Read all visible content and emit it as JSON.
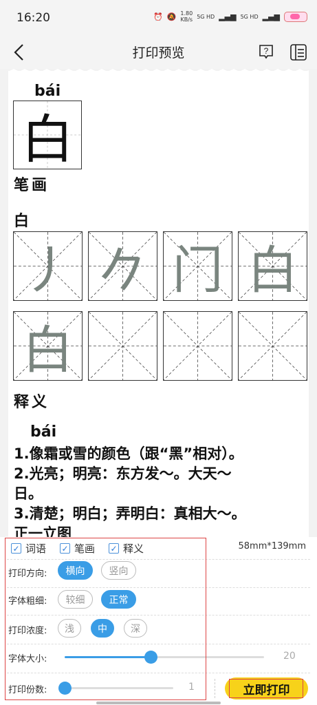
{
  "status": {
    "time": "16:20",
    "net_speed_value": "1.80",
    "net_speed_unit": "KB/s",
    "sig1": "5G HD",
    "sig2": "5G HD"
  },
  "nav": {
    "title": "打印预览"
  },
  "preview": {
    "pinyin": "bái",
    "character": "白",
    "stroke_title": "笔画",
    "stroke_char_label": "白",
    "strokes": [
      "丿",
      "𠂊",
      "门",
      "白",
      "白",
      "",
      "",
      ""
    ],
    "meaning_title": "释义",
    "meaning_pinyin": "bái",
    "meanings": [
      "1.像霜或雪的颜色（跟“黑”相对）。",
      "2.光亮；明亮：东方发～。大天～",
      "日。",
      "3.清楚；明白；弄明白：真相大～。",
      "正一立图"
    ]
  },
  "settings": {
    "checkboxes": [
      "词语",
      "笔画",
      "释义"
    ],
    "paper_size": "58mm*139mm",
    "direction": {
      "label": "打印方向:",
      "options": [
        "横向",
        "竖向"
      ],
      "selected": 0
    },
    "thickness": {
      "label": "字体粗细:",
      "options": [
        "较细",
        "正常"
      ],
      "selected": 1
    },
    "density": {
      "label": "打印浓度:",
      "options": [
        "浅",
        "中",
        "深"
      ],
      "selected": 1
    },
    "font_size": {
      "label": "字体大小:",
      "value": "20",
      "fraction": 0.43
    },
    "copies": {
      "label": "打印份数:",
      "value": "1",
      "fraction": 0.0
    },
    "print_button": "立即打印"
  },
  "colors": {
    "accent": "#3a9de6",
    "print_button": "#f7d21a",
    "highlight": "#dd4444"
  }
}
